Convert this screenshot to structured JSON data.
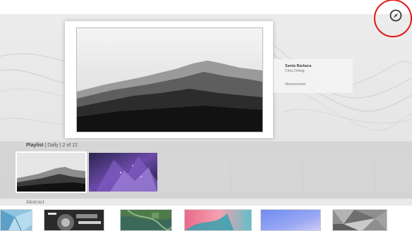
{
  "current_artwork": {
    "title": "Santa Barbara",
    "artist": "Chris Ortwig",
    "collection": "Monochrome"
  },
  "playlist": {
    "label": "Playlist",
    "separator": "|",
    "schedule": "Daily",
    "position": "2 of 12",
    "items": [
      {
        "name": "misty-mountains",
        "selected": true
      },
      {
        "name": "purple-crystal",
        "selected": false
      },
      {
        "name": "empty",
        "selected": false
      },
      {
        "name": "empty",
        "selected": false
      },
      {
        "name": "empty",
        "selected": false
      },
      {
        "name": "empty",
        "selected": false
      }
    ]
  },
  "category": {
    "label": "Abstract",
    "items": [
      "blue-glass",
      "motorcycle-engine",
      "aerial-green",
      "pink-teal-abstract",
      "blue-gradient",
      "gray-low-poly"
    ]
  },
  "icons": {
    "compass": "compass-icon"
  },
  "colors": {
    "highlight_circle": "#e01818",
    "background": "#e8e8e8",
    "playlist_band": "#c8c8c8"
  }
}
